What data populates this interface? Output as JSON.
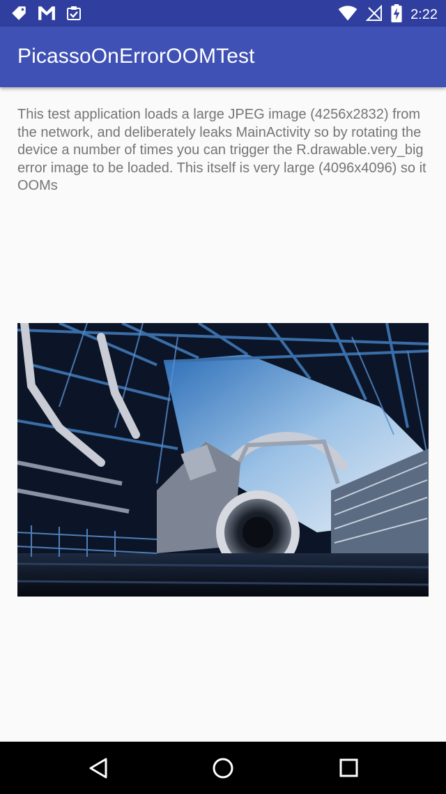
{
  "status_bar": {
    "time": "2:22",
    "left_icons": [
      "tag-icon",
      "gmail-icon",
      "clipboard-check-icon"
    ],
    "right_icons": [
      "wifi-icon",
      "no-signal-icon",
      "battery-charging-icon"
    ]
  },
  "app_bar": {
    "title": "PicassoOnErrorOOMTest",
    "color": "#3f51b5",
    "status_color": "#303f9f"
  },
  "content": {
    "description": "This test application loads a large JPEG image (4256x2832) from the network, and deliberately leaks MainActivity so by rotating the device a number of times you can trigger the R.drawable.very_big error image to be loaded. This itself is very large (4096x4096) so it OOMs"
  },
  "nav_bar": {
    "buttons": [
      "back-triangle-icon",
      "home-circle-icon",
      "recents-square-icon"
    ]
  }
}
